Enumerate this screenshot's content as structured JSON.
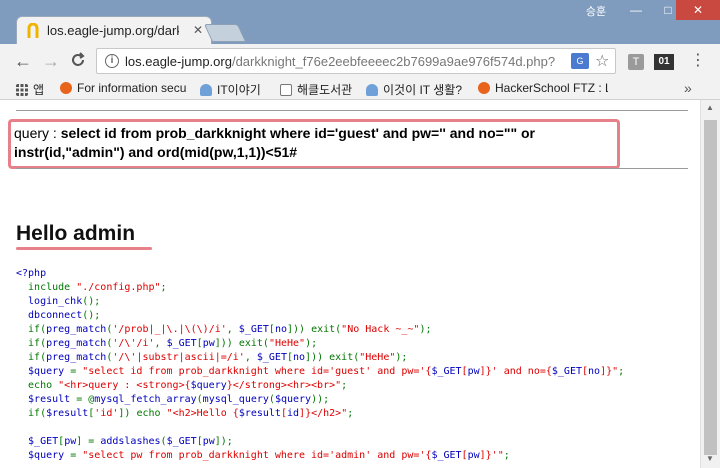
{
  "window": {
    "user_label": "승훈",
    "min_glyph": "—",
    "max_glyph": "□",
    "close_glyph": "✕"
  },
  "tab": {
    "title": "los.eagle-jump.org/dark",
    "close_glyph": "✕"
  },
  "toolbar": {
    "back_glyph": "←",
    "forward_glyph": "→",
    "reload_glyph": "C",
    "info_glyph": "i",
    "url_host": "los.eagle-jump.org",
    "url_path": "/darkknight_f76e2eebfeeeec2b7699a9ae976f574d.php?",
    "translate_glyph": "G",
    "star_glyph": "☆",
    "ext1_glyph": "T",
    "ext2_glyph": "01",
    "menu_glyph": "⋮"
  },
  "bookmarks": {
    "apps": "앱",
    "items": [
      {
        "label": "For information secu",
        "icon": "orange-shield-icon"
      },
      {
        "label": "IT이야기",
        "icon": "person-icon"
      },
      {
        "label": "해클도서관",
        "icon": "page-icon"
      },
      {
        "label": "이것이 IT 생활?",
        "icon": "person-icon"
      },
      {
        "label": "HackerSchool FTZ : L",
        "icon": "orange-shield-icon"
      }
    ],
    "more_glyph": "»"
  },
  "page": {
    "query_label": "query : ",
    "query_sql_line1": "select id from prob_darkknight where id='guest' and pw='' and no=\"\" or",
    "query_sql_line2": "instr(id,\"admin\") and ord(mid(pw,1,1))<51#",
    "hello": "Hello admin"
  },
  "code_lines": [
    [
      {
        "t": "<?php",
        "c": "blue"
      }
    ],
    [
      {
        "t": "  include ",
        "c": "green"
      },
      {
        "t": "\"./config.php\"",
        "c": "red"
      },
      {
        "t": ";",
        "c": "green"
      }
    ],
    [
      {
        "t": "  login_chk",
        "c": "blue"
      },
      {
        "t": "();",
        "c": "green"
      }
    ],
    [
      {
        "t": "  dbconnect",
        "c": "blue"
      },
      {
        "t": "();",
        "c": "green"
      }
    ],
    [
      {
        "t": "  if(",
        "c": "green"
      },
      {
        "t": "preg_match",
        "c": "blue"
      },
      {
        "t": "(",
        "c": "green"
      },
      {
        "t": "'/prob|_|\\.|\\(\\)/i'",
        "c": "red"
      },
      {
        "t": ", ",
        "c": "green"
      },
      {
        "t": "$_GET",
        "c": "blue"
      },
      {
        "t": "[",
        "c": "green"
      },
      {
        "t": "no",
        "c": "blue"
      },
      {
        "t": "])) exit(",
        "c": "green"
      },
      {
        "t": "\"No Hack ~_~\"",
        "c": "red"
      },
      {
        "t": ");",
        "c": "green"
      }
    ],
    [
      {
        "t": "  if(",
        "c": "green"
      },
      {
        "t": "preg_match",
        "c": "blue"
      },
      {
        "t": "(",
        "c": "green"
      },
      {
        "t": "'/\\'/i'",
        "c": "red"
      },
      {
        "t": ", ",
        "c": "green"
      },
      {
        "t": "$_GET",
        "c": "blue"
      },
      {
        "t": "[",
        "c": "green"
      },
      {
        "t": "pw",
        "c": "blue"
      },
      {
        "t": "])) exit(",
        "c": "green"
      },
      {
        "t": "\"HeHe\"",
        "c": "red"
      },
      {
        "t": ");",
        "c": "green"
      }
    ],
    [
      {
        "t": "  if(",
        "c": "green"
      },
      {
        "t": "preg_match",
        "c": "blue"
      },
      {
        "t": "(",
        "c": "green"
      },
      {
        "t": "'/\\'|substr|ascii|=/i'",
        "c": "red"
      },
      {
        "t": ", ",
        "c": "green"
      },
      {
        "t": "$_GET",
        "c": "blue"
      },
      {
        "t": "[",
        "c": "green"
      },
      {
        "t": "no",
        "c": "blue"
      },
      {
        "t": "])) exit(",
        "c": "green"
      },
      {
        "t": "\"HeHe\"",
        "c": "red"
      },
      {
        "t": ");",
        "c": "green"
      }
    ],
    [
      {
        "t": "  $query ",
        "c": "blue"
      },
      {
        "t": "= ",
        "c": "green"
      },
      {
        "t": "\"select id from prob_darkknight where id='guest' and pw='{",
        "c": "red"
      },
      {
        "t": "$_GET",
        "c": "blue"
      },
      {
        "t": "[",
        "c": "red"
      },
      {
        "t": "pw",
        "c": "blue"
      },
      {
        "t": "]",
        "c": "red"
      },
      {
        "t": "}' and no={",
        "c": "red"
      },
      {
        "t": "$_GET",
        "c": "blue"
      },
      {
        "t": "[",
        "c": "red"
      },
      {
        "t": "no",
        "c": "blue"
      },
      {
        "t": "]",
        "c": "red"
      },
      {
        "t": "}\"",
        "c": "red"
      },
      {
        "t": ";",
        "c": "green"
      }
    ],
    [
      {
        "t": "  echo ",
        "c": "green"
      },
      {
        "t": "\"<hr>query : <strong>{",
        "c": "red"
      },
      {
        "t": "$query",
        "c": "blue"
      },
      {
        "t": "}</strong><hr><br>\"",
        "c": "red"
      },
      {
        "t": ";",
        "c": "green"
      }
    ],
    [
      {
        "t": "  $result ",
        "c": "blue"
      },
      {
        "t": "= @",
        "c": "green"
      },
      {
        "t": "mysql_fetch_array",
        "c": "blue"
      },
      {
        "t": "(",
        "c": "green"
      },
      {
        "t": "mysql_query",
        "c": "blue"
      },
      {
        "t": "(",
        "c": "green"
      },
      {
        "t": "$query",
        "c": "blue"
      },
      {
        "t": "));",
        "c": "green"
      }
    ],
    [
      {
        "t": "  if(",
        "c": "green"
      },
      {
        "t": "$result",
        "c": "blue"
      },
      {
        "t": "[",
        "c": "green"
      },
      {
        "t": "'id'",
        "c": "red"
      },
      {
        "t": "]) echo ",
        "c": "green"
      },
      {
        "t": "\"<h2>Hello {",
        "c": "red"
      },
      {
        "t": "$result",
        "c": "blue"
      },
      {
        "t": "[",
        "c": "red"
      },
      {
        "t": "id",
        "c": "blue"
      },
      {
        "t": "]",
        "c": "red"
      },
      {
        "t": "}</h2>\"",
        "c": "red"
      },
      {
        "t": ";",
        "c": "green"
      }
    ],
    [
      {
        "t": "",
        "c": "def"
      }
    ],
    [
      {
        "t": "  $_GET",
        "c": "blue"
      },
      {
        "t": "[",
        "c": "green"
      },
      {
        "t": "pw",
        "c": "blue"
      },
      {
        "t": "] = ",
        "c": "green"
      },
      {
        "t": "addslashes",
        "c": "blue"
      },
      {
        "t": "(",
        "c": "green"
      },
      {
        "t": "$_GET",
        "c": "blue"
      },
      {
        "t": "[",
        "c": "green"
      },
      {
        "t": "pw",
        "c": "blue"
      },
      {
        "t": "]);",
        "c": "green"
      }
    ],
    [
      {
        "t": "  $query ",
        "c": "blue"
      },
      {
        "t": "= ",
        "c": "green"
      },
      {
        "t": "\"select pw from prob_darkknight where id='admin' and pw='{",
        "c": "red"
      },
      {
        "t": "$_GET",
        "c": "blue"
      },
      {
        "t": "[",
        "c": "red"
      },
      {
        "t": "pw",
        "c": "blue"
      },
      {
        "t": "]",
        "c": "red"
      },
      {
        "t": "}'\"",
        "c": "red"
      },
      {
        "t": ";",
        "c": "green"
      }
    ]
  ],
  "colors": {
    "highlight": "#e8808a",
    "php_blue": "#0000bb",
    "php_green": "#007700",
    "php_red": "#dd0000"
  }
}
